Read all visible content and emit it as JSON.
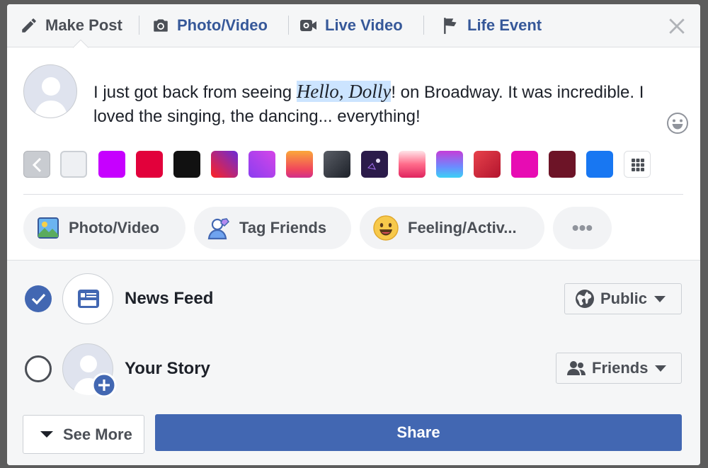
{
  "header": {
    "tabs": [
      {
        "label": "Make Post",
        "icon": "pencil-icon"
      },
      {
        "label": "Photo/Video",
        "icon": "camera-icon"
      },
      {
        "label": "Live Video",
        "icon": "video-camera-icon"
      },
      {
        "label": "Life Event",
        "icon": "flag-icon"
      }
    ],
    "close_icon": "close-icon"
  },
  "composer": {
    "text_before": "I just got back from seeing ",
    "highlight_part1": "Hello",
    "highlight_comma": ", ",
    "highlight_part2": "Dolly",
    "text_after": "! on Broadway. It was incredible. I loved the singing, the dancing... everything!",
    "emoji_icon": "smiley-icon"
  },
  "background_swatches": [
    {
      "name": "back",
      "color": "#c9ccd1"
    },
    {
      "name": "white",
      "color": "#eef0f3"
    },
    {
      "name": "purple",
      "color": "#c600ff"
    },
    {
      "name": "red",
      "color": "#e2013b"
    },
    {
      "name": "black",
      "color": "#111111"
    },
    {
      "name": "purple-red-gradient",
      "color": "#8e2de2"
    },
    {
      "name": "violet-gradient",
      "color": "#b543f0"
    },
    {
      "name": "orange-pink-gradient",
      "color": "#f9a43a"
    },
    {
      "name": "dark-grey-gradient",
      "color": "#4b4f56"
    },
    {
      "name": "space-dark",
      "color": "#2b1b4a"
    },
    {
      "name": "pink-gradient",
      "color": "#ff6b8a"
    },
    {
      "name": "blue-purple-gradient",
      "color": "#6b8cff"
    },
    {
      "name": "red-rose-gradient",
      "color": "#d4293f"
    },
    {
      "name": "magenta",
      "color": "#e70cb3"
    },
    {
      "name": "maroon",
      "color": "#6d1427"
    },
    {
      "name": "blue",
      "color": "#1877f2"
    },
    {
      "name": "more-grid",
      "color": "#ffffff"
    }
  ],
  "actions": [
    {
      "label": "Photo/Video",
      "icon": "photo-icon"
    },
    {
      "label": "Tag Friends",
      "icon": "tag-friends-icon"
    },
    {
      "label": "Feeling/Activ...",
      "icon": "feeling-smiley-icon"
    },
    {
      "label": "•••",
      "icon": "more-icon"
    }
  ],
  "destinations": [
    {
      "label": "News Feed",
      "checked": true,
      "audience": "Public"
    },
    {
      "label": "Your Story",
      "checked": false,
      "audience": "Friends"
    }
  ],
  "footer": {
    "see_more": "See More",
    "share": "Share"
  },
  "colors": {
    "brand_blue": "#4267b2",
    "link_blue": "#365899",
    "text_dark": "#1d2129",
    "text_grey": "#4b4f56"
  }
}
